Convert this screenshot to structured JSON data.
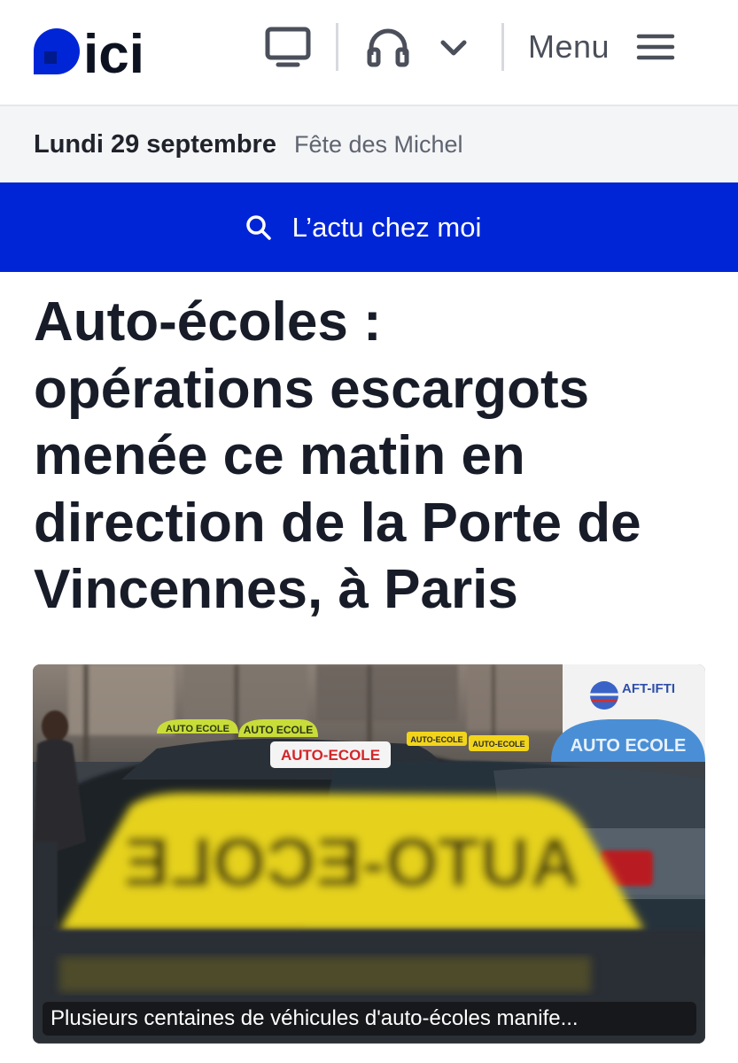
{
  "header": {
    "logo_text": "ici",
    "menu_label": "Menu",
    "icons": [
      "tv-icon",
      "headphones-icon",
      "chevron-down-icon",
      "hamburger-icon"
    ]
  },
  "datebar": {
    "date": "Lundi 29 septembre",
    "fete": "Fête des Michel"
  },
  "local_news": {
    "label": "L’actu chez moi",
    "icon": "search-icon"
  },
  "article": {
    "title_lines": [
      "Auto-écoles :",
      "opérations escargots",
      "menée ce matin en",
      "direction de la Porte de",
      "Vincennes, à Paris"
    ],
    "image": {
      "sign_blur_text": "AUTO-ECOLE",
      "sign_red_text": "AUTO-ECOLE",
      "sign_small_a": "AUTO-ECOLE",
      "sign_small_b": "AUTO-ECOLE",
      "sign_green_a": "AUTO ECOLE",
      "sign_green_b": "AUTO ECOLE",
      "sign_blue": "AUTO ECOLE",
      "truck_text": "AFT-IFTI",
      "caption": "Plusieurs centaines de véhicules d'auto-écoles manife..."
    }
  },
  "colors": {
    "brand_blue": "#0025d6",
    "headline": "#171c28"
  }
}
